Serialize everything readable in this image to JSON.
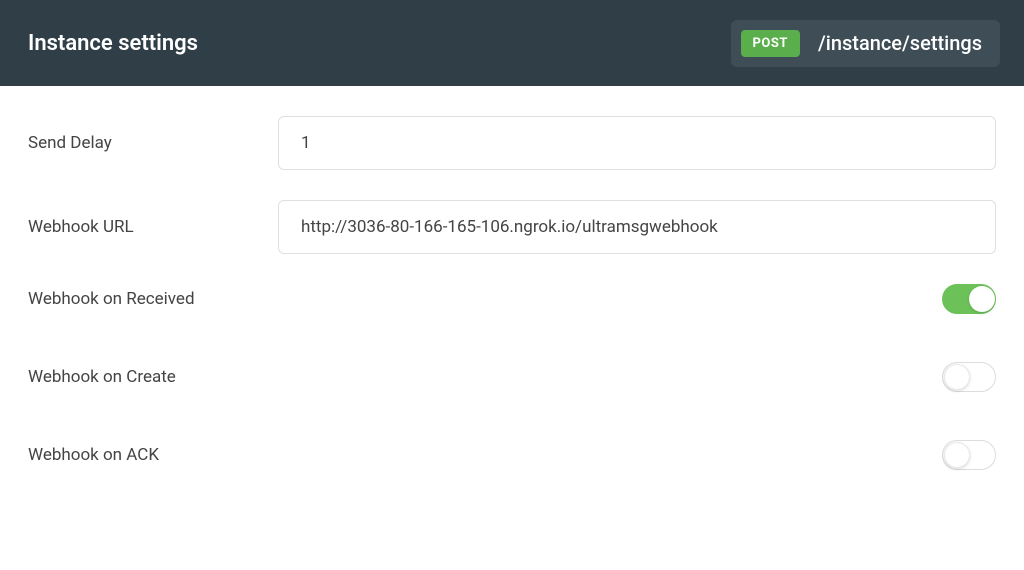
{
  "header": {
    "title": "Instance settings",
    "method": "POST",
    "path": "/instance/settings"
  },
  "form": {
    "sendDelay": {
      "label": "Send Delay",
      "value": "1"
    },
    "webhookUrl": {
      "label": "Webhook URL",
      "value": "http://3036-80-166-165-106.ngrok.io/ultramsgwebhook"
    },
    "webhookOnReceived": {
      "label": "Webhook on Received",
      "enabled": true
    },
    "webhookOnCreate": {
      "label": "Webhook on Create",
      "enabled": false
    },
    "webhookOnAck": {
      "label": "Webhook on ACK",
      "enabled": false
    }
  }
}
